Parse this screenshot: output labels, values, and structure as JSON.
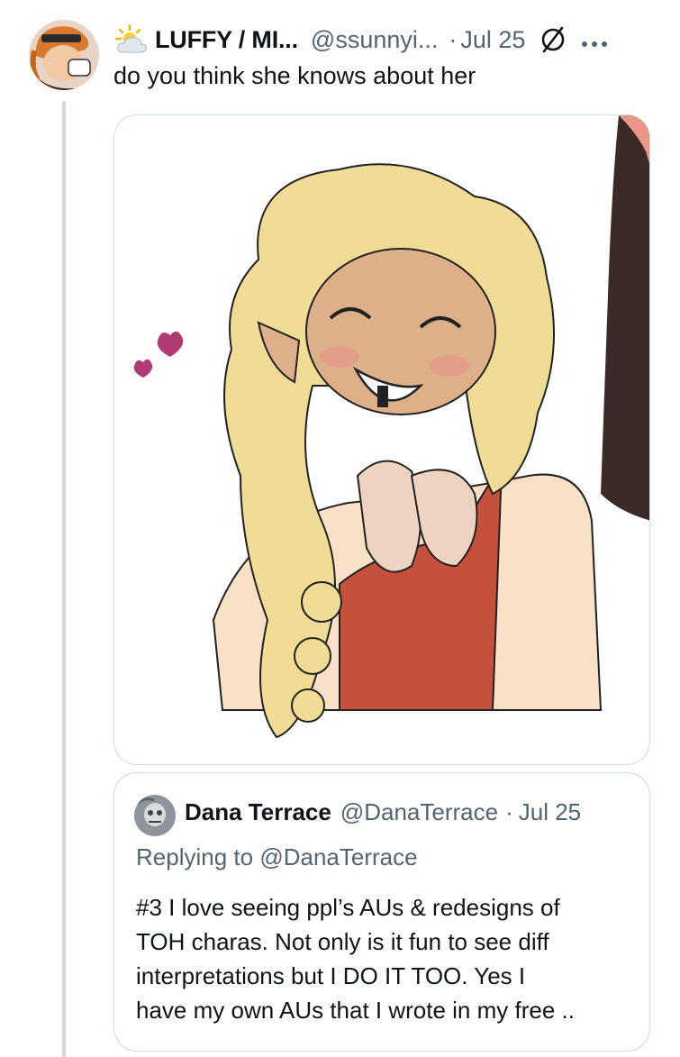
{
  "tweet": {
    "author_name": "LUFFY / MI...",
    "author_handle": "@ssunnyi...",
    "separator": "·",
    "date": "Jul 25",
    "text": "do you think she knows about her",
    "header_emoji": "sun-behind-cloud-icon"
  },
  "media": {
    "description_icon": "drawing-image"
  },
  "quoted_tweet": {
    "author_name": "Dana Terrace",
    "author_handle": "@DanaTerrace",
    "separator": "·",
    "date": "Jul 25",
    "replying_prefix": "Replying to",
    "replying_to": "@DanaTerrace",
    "body_lines": [
      "#3 I love seeing ppl’s AUs & redesigns of",
      "TOH charas. Not only is it fun to see diff",
      "interpretations but I DO IT TOO. Yes I",
      "have my own AUs that I wrote in my free .."
    ]
  },
  "colors": {
    "text_primary": "#0f1419",
    "text_secondary": "#536471",
    "border": "#cfd9de"
  }
}
